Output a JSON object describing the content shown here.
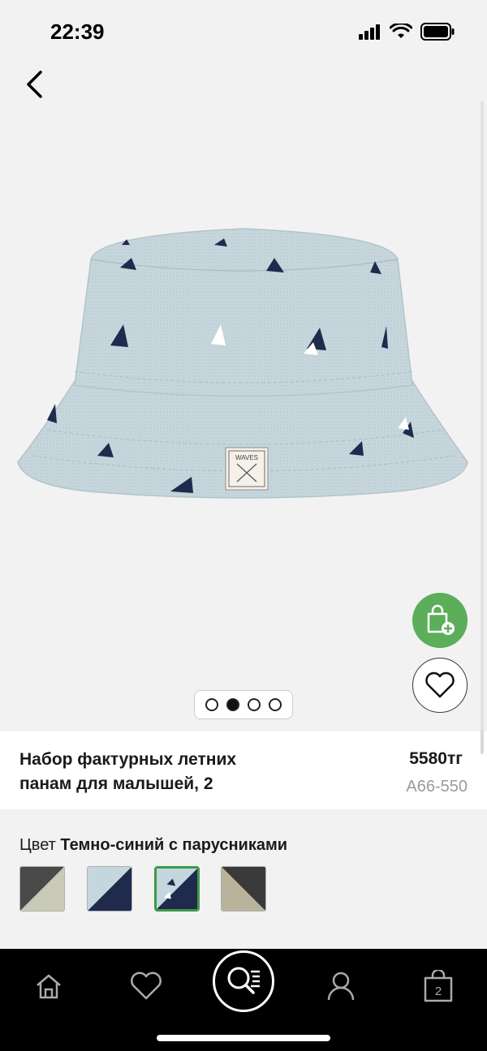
{
  "status_bar": {
    "time": "22:39"
  },
  "product": {
    "title": "Набор фактурных летних панам для малышей, 2",
    "price": "5580тг",
    "sku": "A66-550",
    "label_text": "WAVES"
  },
  "gallery": {
    "image_count": 4,
    "active_index": 1
  },
  "color": {
    "prefix": "Цвет",
    "selected_name": "Темно-синий с парусниками",
    "swatches": [
      {
        "name": "swatch-gray-beige",
        "top": "#4a4a4a",
        "bottom": "#c9cbb8"
      },
      {
        "name": "swatch-navy-lightblue",
        "top": "#1f2a4d",
        "bottom": "#c4d6de"
      },
      {
        "name": "swatch-navy-sailboats",
        "top": "#1f2a4d",
        "bottom": "#c4d6de"
      },
      {
        "name": "swatch-dark-khaki",
        "top": "#3a3a3a",
        "bottom": "#b8b39a"
      }
    ]
  },
  "tab_bar": {
    "cart_count": "2"
  },
  "colors": {
    "accent_green": "#5cae5a",
    "selected_border": "#3e9a46",
    "background": "#f2f2f2",
    "tab_bar": "#000000"
  }
}
